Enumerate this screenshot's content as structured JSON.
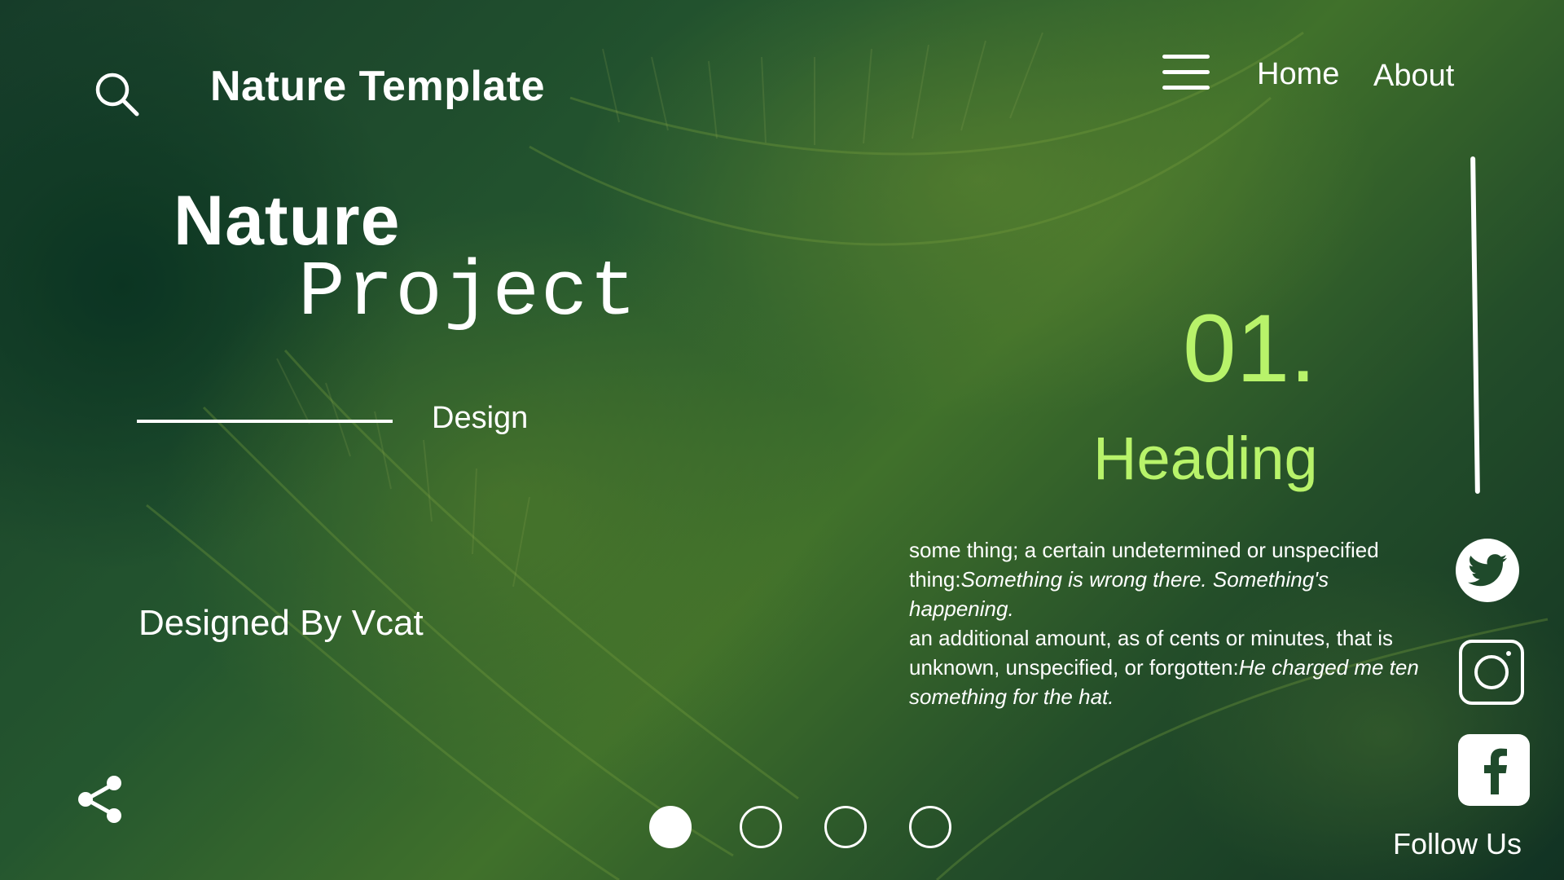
{
  "header": {
    "brand": "Nature Template",
    "nav": [
      {
        "label": "Home"
      },
      {
        "label": "About"
      }
    ]
  },
  "hero": {
    "title_line1": "Nature",
    "title_line2": "Project",
    "subtitle": "Design",
    "credit": "Designed By Vcat"
  },
  "feature": {
    "number": "01.",
    "heading": "Heading",
    "desc_p1_plain": "some thing; a certain undetermined or unspecified thing:",
    "desc_p1_italic": "Something is wrong there. Something's happening.",
    "desc_p2_plain": "an additional amount, as of cents or minutes, that is unknown, unspecified, or forgotten:",
    "desc_p2_italic": "He charged me ten something for the hat."
  },
  "social": {
    "items": [
      {
        "icon": "twitter-icon"
      },
      {
        "icon": "instagram-icon"
      },
      {
        "icon": "facebook-icon"
      }
    ],
    "follow_label": "Follow Us"
  },
  "pagination": {
    "active_index": 0,
    "count": 4
  },
  "colors": {
    "accent": "#b8f36a",
    "text": "#ffffff"
  }
}
